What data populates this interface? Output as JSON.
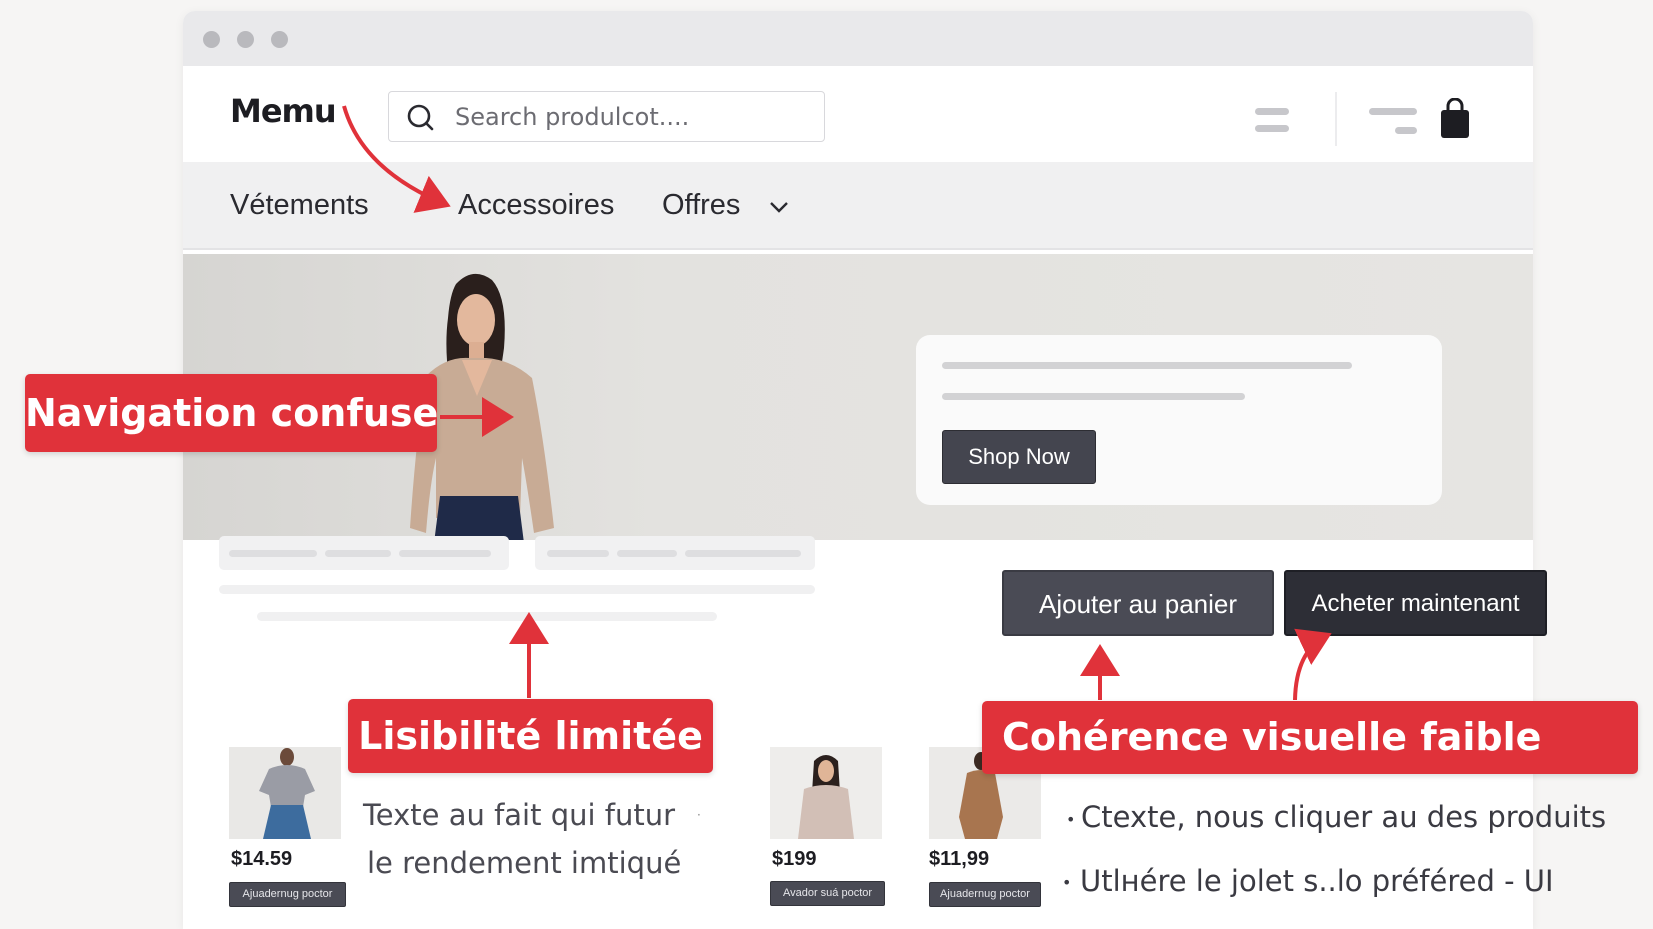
{
  "header": {
    "logo": "Memu",
    "search_placeholder": "Search produlcot...."
  },
  "nav": {
    "items": [
      "Vétements",
      "Accessoires",
      "Offres"
    ]
  },
  "hero": {
    "shop_button": "Shop Now"
  },
  "actions": {
    "add_to_cart": "Ajouter au panier",
    "buy_now": "Acheter maintenant"
  },
  "products": [
    {
      "price": "$14.59",
      "button": "Ajuadernug poctor"
    },
    {
      "price": "$199",
      "button": "Avador suá poctor"
    },
    {
      "price": "$11,99",
      "button": "Ajuadernug poctor"
    }
  ],
  "body_text": {
    "line1": "Texte au fait qui futur",
    "line2": "le rendement imtiqué"
  },
  "bullets": [
    "Ctexte, nous cliquer au des produits",
    "Utlнére le jolet s..lo préféred - UI"
  ],
  "callouts": {
    "navigation": "Navigation confuse",
    "legibility": "Lisibilité limitée",
    "coherence": "Cohérence visuelle faible"
  },
  "colors": {
    "callout_red": "#e0323a",
    "button_dark": "#2d2e36",
    "button_gray": "#4a4b55"
  },
  "icons": [
    "search-icon",
    "menu-icon",
    "filter-icon",
    "shopping-bag-icon",
    "chevron-down-icon"
  ]
}
